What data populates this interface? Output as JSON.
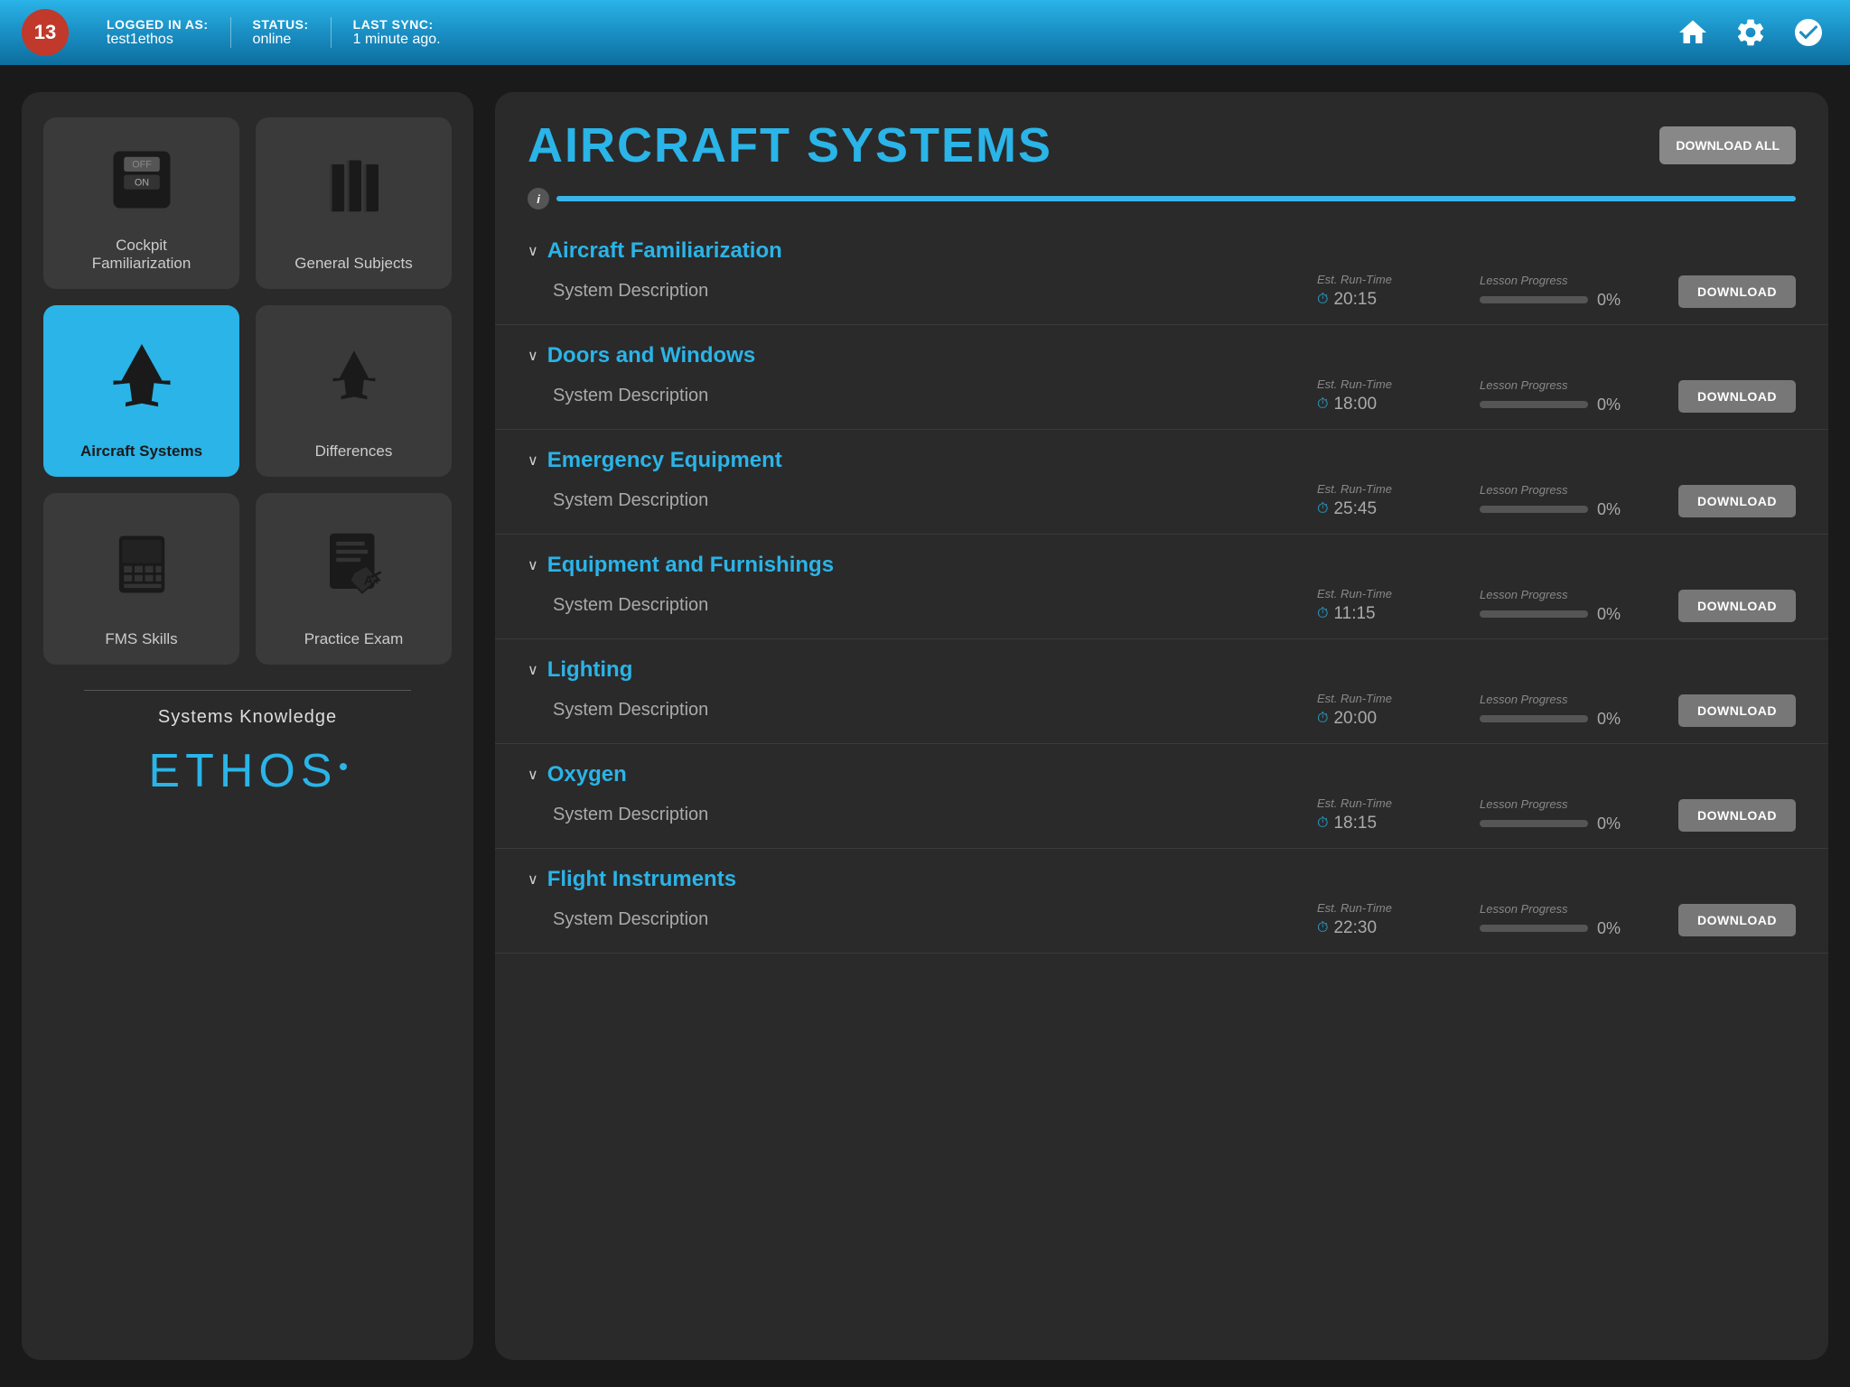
{
  "topbar": {
    "logo": "13",
    "logged_in_label": "LOGGED IN AS:",
    "logged_in_value": "test1ethos",
    "status_label": "STATUS:",
    "status_value": "online",
    "last_sync_label": "LAST SYNC:",
    "last_sync_value": "1 minute ago."
  },
  "left_panel": {
    "tiles": [
      {
        "id": "cockpit",
        "label": "Cockpit\nFamiliarization",
        "active": false,
        "icon": "switch"
      },
      {
        "id": "general",
        "label": "General Subjects",
        "active": false,
        "icon": "books"
      },
      {
        "id": "aircraft",
        "label": "Aircraft Systems",
        "active": true,
        "icon": "plane"
      },
      {
        "id": "differences",
        "label": "Differences",
        "active": false,
        "icon": "plane-small"
      },
      {
        "id": "fms",
        "label": "FMS  Skills",
        "active": false,
        "icon": "fms"
      },
      {
        "id": "practice",
        "label": "Practice Exam",
        "active": false,
        "icon": "exam"
      }
    ],
    "divider": true,
    "footer_label": "Systems Knowledge",
    "brand_logo": "ETHOS"
  },
  "right_panel": {
    "title": "AIRCRAFT SYSTEMS",
    "download_all_label": "DOWNLOAD\nALL",
    "sections": [
      {
        "name": "Aircraft Familiarization",
        "lessons": [
          {
            "name": "System Description",
            "est_run_time_label": "Est. Run-Time",
            "run_time": "20:15",
            "lesson_progress_label": "Lesson Progress",
            "progress": 0,
            "download_label": "DOWNLOAD"
          }
        ]
      },
      {
        "name": "Doors and Windows",
        "lessons": [
          {
            "name": "System Description",
            "est_run_time_label": "Est. Run-Time",
            "run_time": "18:00",
            "lesson_progress_label": "Lesson Progress",
            "progress": 0,
            "download_label": "DOWNLOAD"
          }
        ]
      },
      {
        "name": "Emergency Equipment",
        "lessons": [
          {
            "name": "System Description",
            "est_run_time_label": "Est. Run-Time",
            "run_time": "25:45",
            "lesson_progress_label": "Lesson Progress",
            "progress": 0,
            "download_label": "DOWNLOAD"
          }
        ]
      },
      {
        "name": "Equipment and Furnishings",
        "lessons": [
          {
            "name": "System Description",
            "est_run_time_label": "Est. Run-Time",
            "run_time": "11:15",
            "lesson_progress_label": "Lesson Progress",
            "progress": 0,
            "download_label": "DOWNLOAD"
          }
        ]
      },
      {
        "name": "Lighting",
        "lessons": [
          {
            "name": "System Description",
            "est_run_time_label": "Est. Run-Time",
            "run_time": "20:00",
            "lesson_progress_label": "Lesson Progress",
            "progress": 0,
            "download_label": "DOWNLOAD"
          }
        ]
      },
      {
        "name": "Oxygen",
        "lessons": [
          {
            "name": "System Description",
            "est_run_time_label": "Est. Run-Time",
            "run_time": "18:15",
            "lesson_progress_label": "Lesson Progress",
            "progress": 0,
            "download_label": "DOWNLOAD"
          }
        ]
      },
      {
        "name": "Flight Instruments",
        "lessons": [
          {
            "name": "System Description",
            "est_run_time_label": "Est. Run-Time",
            "run_time": "22:30",
            "lesson_progress_label": "Lesson Progress",
            "progress": 0,
            "download_label": "DOWNLOAD"
          }
        ]
      }
    ]
  }
}
